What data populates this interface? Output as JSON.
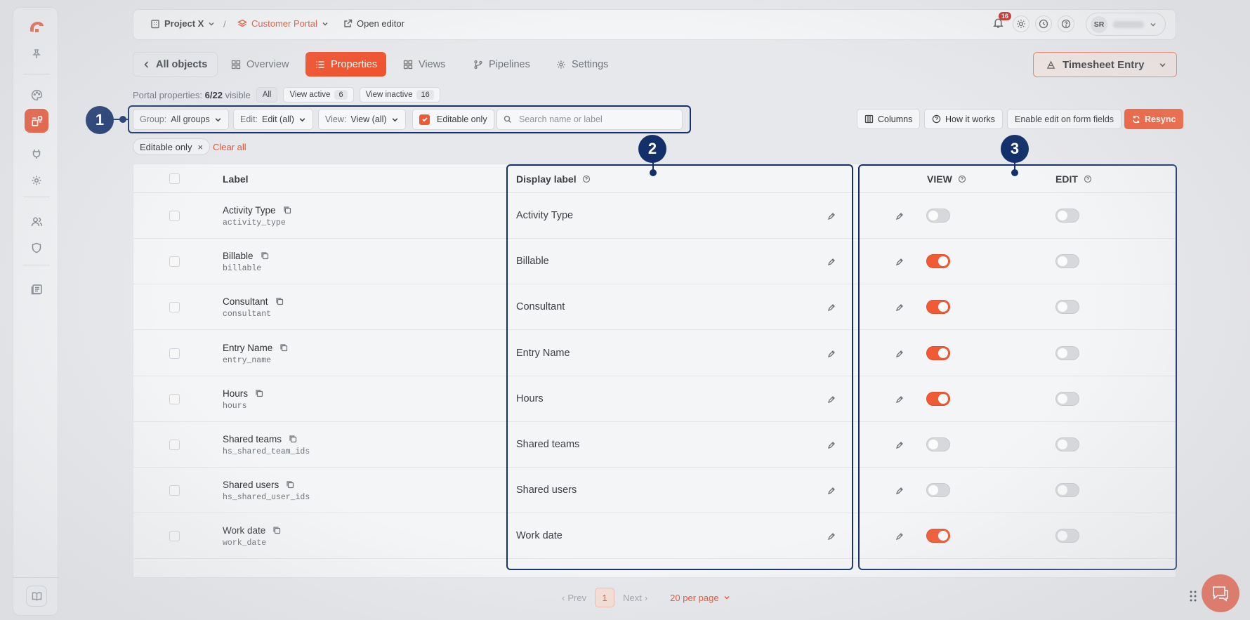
{
  "topbar": {
    "project": "Project X",
    "separator": "/",
    "portal": "Customer Portal",
    "open_editor": "Open editor",
    "notification_count": "16",
    "user_initials": "SR"
  },
  "tabs": {
    "back": "All objects",
    "items": [
      "Overview",
      "Properties",
      "Views",
      "Pipelines",
      "Settings"
    ],
    "active": "Properties"
  },
  "entity": {
    "label": "Timesheet Entry"
  },
  "summary": {
    "prefix": "Portal properties:",
    "count": "6/22",
    "suffix": "visible",
    "all": "All",
    "view_active": "View active",
    "view_active_count": "6",
    "view_inactive": "View inactive",
    "view_inactive_count": "16"
  },
  "filters": {
    "group_label": "Group:",
    "group_value": "All groups",
    "edit_label": "Edit:",
    "edit_value": "Edit (all)",
    "view_label": "View:",
    "view_value": "View (all)",
    "editable_only": "Editable only",
    "search_placeholder": "Search name or label"
  },
  "actions": {
    "columns": "Columns",
    "how_it_works": "How it works",
    "enable_edit": "Enable edit on form fields",
    "resync": "Resync"
  },
  "chips": {
    "editable_only": "Editable only",
    "clear_all": "Clear all"
  },
  "table": {
    "headers": {
      "label": "Label",
      "display_label": "Display label",
      "view": "VIEW",
      "edit": "EDIT"
    },
    "rows": [
      {
        "label": "Activity Type",
        "api": "activity_type",
        "display": "Activity Type",
        "view": false,
        "edit": false
      },
      {
        "label": "Billable",
        "api": "billable",
        "display": "Billable",
        "view": true,
        "edit": false
      },
      {
        "label": "Consultant",
        "api": "consultant",
        "display": "Consultant",
        "view": true,
        "edit": false
      },
      {
        "label": "Entry Name",
        "api": "entry_name",
        "display": "Entry Name",
        "view": true,
        "edit": false
      },
      {
        "label": "Hours",
        "api": "hours",
        "display": "Hours",
        "view": true,
        "edit": false
      },
      {
        "label": "Shared teams",
        "api": "hs_shared_team_ids",
        "display": "Shared teams",
        "view": false,
        "edit": false
      },
      {
        "label": "Shared users",
        "api": "hs_shared_user_ids",
        "display": "Shared users",
        "view": false,
        "edit": false
      },
      {
        "label": "Work date",
        "api": "work_date",
        "display": "Work date",
        "view": true,
        "edit": false
      }
    ]
  },
  "callouts": [
    "1",
    "2",
    "3"
  ],
  "pagination": {
    "prev": "Prev",
    "page": "1",
    "next": "Next",
    "per_page": "20 per page"
  },
  "colors": {
    "accent": "#f0522d",
    "callout": "#14306a"
  }
}
